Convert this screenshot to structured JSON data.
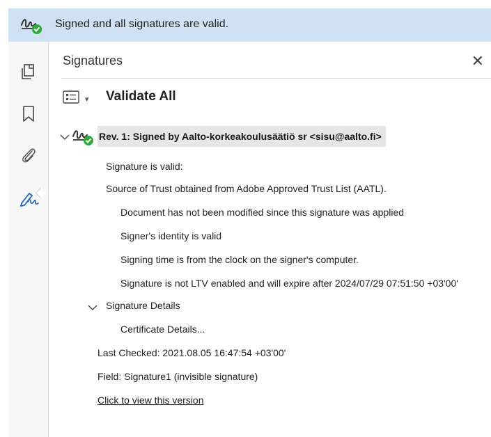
{
  "banner": {
    "message": "Signed and all signatures are valid.",
    "icon": "signature-valid-icon"
  },
  "left_rail": {
    "items": [
      {
        "icon": "pages-icon"
      },
      {
        "icon": "bookmark-icon"
      },
      {
        "icon": "attachment-icon"
      },
      {
        "icon": "signature-panel-icon",
        "active": true
      }
    ]
  },
  "panel": {
    "title": "Signatures",
    "close_symbol": "✕",
    "validate_label": "Validate All",
    "revision": {
      "label": "Rev. 1: Signed by Aalto-korkeakoulusäätiö sr <sisu@aalto.fi>",
      "lines": [
        "Signature is valid:",
        "Source of Trust obtained from Adobe Approved Trust List (AATL).",
        "Document has not been modified since this signature was applied",
        "Signer's identity is valid",
        "Signing time is from the clock on the signer's computer.",
        "Signature is not LTV enabled and will expire after 2024/07/29 07:51:50 +03'00'"
      ],
      "details_label": "Signature Details",
      "certificate_label": "Certificate Details...",
      "last_checked": "Last Checked: 2021.08.05 16:47:54 +03'00'",
      "field": "Field: Signature1 (invisible signature)",
      "view_version_link": "Click to view this version"
    }
  },
  "colors": {
    "banner_bg": "#cfe1f3",
    "valid_green": "#2eaa3a",
    "accent_blue": "#1d64c8"
  }
}
